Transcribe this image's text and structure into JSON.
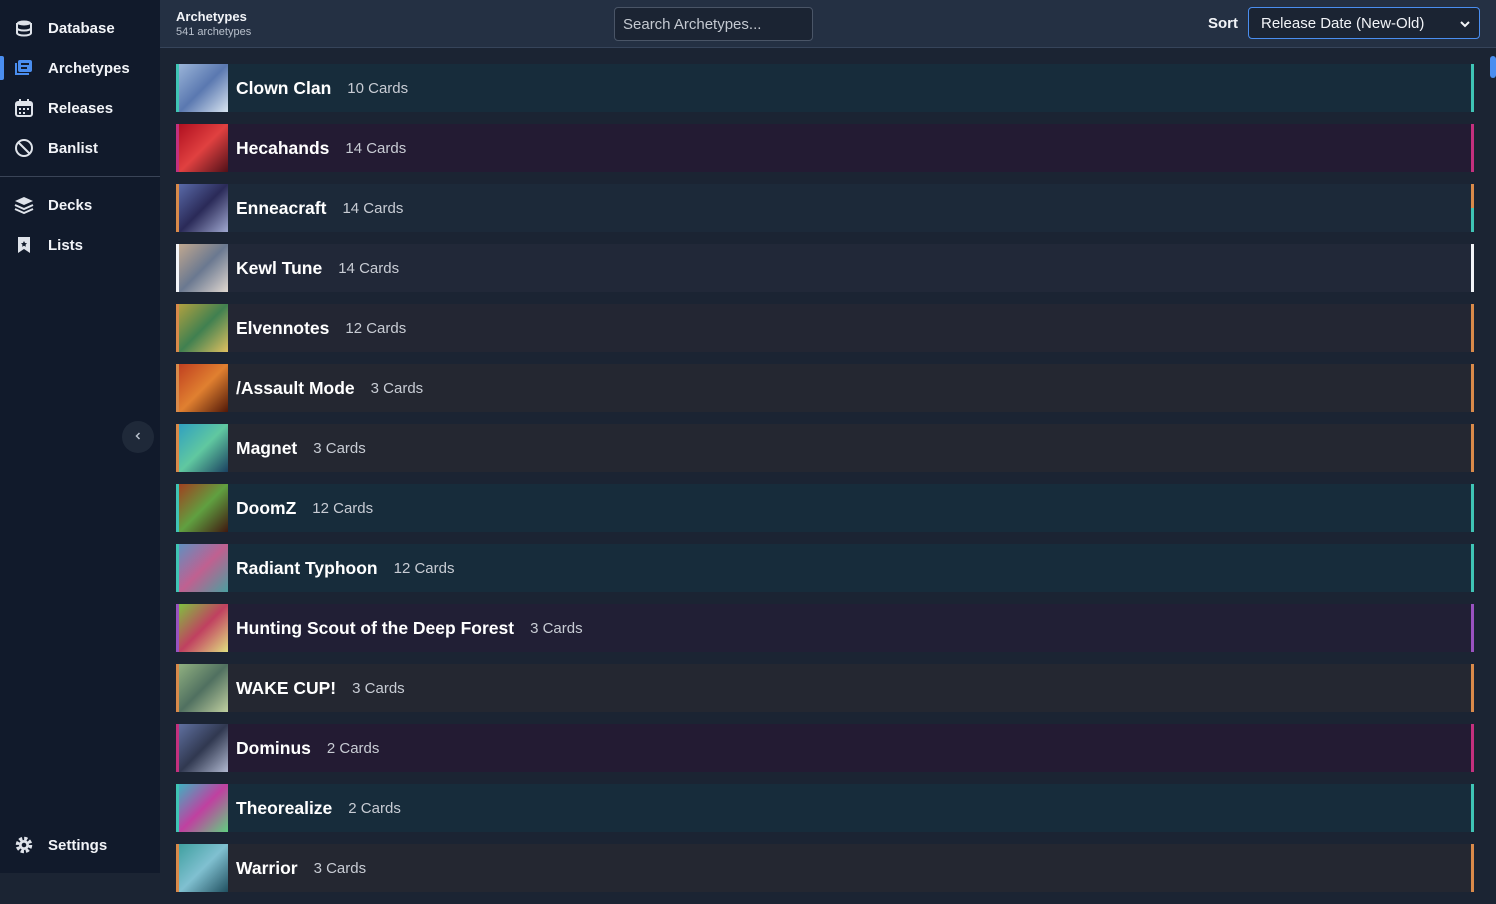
{
  "sidebar": {
    "nav": [
      {
        "label": "Database",
        "icon": "database-icon",
        "active": false
      },
      {
        "label": "Archetypes",
        "icon": "archetypes-icon",
        "active": true
      },
      {
        "label": "Releases",
        "icon": "calendar-icon",
        "active": false
      },
      {
        "label": "Banlist",
        "icon": "ban-icon",
        "active": false
      }
    ],
    "secondary": [
      {
        "label": "Decks",
        "icon": "layers-icon"
      },
      {
        "label": "Lists",
        "icon": "bookmark-icon"
      }
    ],
    "settings": {
      "label": "Settings",
      "icon": "gear-icon"
    }
  },
  "header": {
    "title": "Archetypes",
    "subtitle": "541 archetypes",
    "search_placeholder": "Search Archetypes...",
    "sort_label": "Sort",
    "sort_value": "Release Date (New-Old)"
  },
  "archetypes": [
    {
      "name": "Clown Clan",
      "count": "10 Cards",
      "bg": "#172c3b",
      "accent": "#3fc4b5",
      "thumb": [
        "#9ab4d8",
        "#5a78b0",
        "#d8e4f0"
      ]
    },
    {
      "name": "Hecahands",
      "count": "14 Cards",
      "bg": "#231b33",
      "accent": "#c4307e",
      "thumb": [
        "#b01020",
        "#e04040",
        "#501018"
      ]
    },
    {
      "name": "Enneacraft",
      "count": "14 Cards",
      "bg": "#1c2939",
      "accent": "#d98a4a",
      "thumb": [
        "#5a6aa8",
        "#2a2a58",
        "#a0a8d0"
      ],
      "accent2": "#3fc4b5"
    },
    {
      "name": "Kewl Tune",
      "count": "14 Cards",
      "bg": "#212838",
      "accent": "#f2f4f8",
      "thumb": [
        "#c0a890",
        "#6a7890",
        "#e0d8d0"
      ]
    },
    {
      "name": "Elvennotes",
      "count": "12 Cards",
      "bg": "#232633",
      "accent": "#d98a4a",
      "thumb": [
        "#b0a040",
        "#408050",
        "#e0c060"
      ]
    },
    {
      "name": "/Assault Mode",
      "count": "3 Cards",
      "bg": "#242731",
      "accent": "#d98a4a",
      "thumb": [
        "#c04020",
        "#e08030",
        "#501808"
      ]
    },
    {
      "name": "Magnet",
      "count": "3 Cards",
      "bg": "#242731",
      "accent": "#d98a4a",
      "thumb": [
        "#30a0c0",
        "#60c8a0",
        "#1a4060"
      ]
    },
    {
      "name": "DoomZ",
      "count": "12 Cards",
      "bg": "#172c3b",
      "accent": "#3fc4b5",
      "thumb": [
        "#a04020",
        "#60a040",
        "#401810"
      ]
    },
    {
      "name": "Radiant Typhoon",
      "count": "12 Cards",
      "bg": "#172c3b",
      "accent": "#3fc4b5",
      "thumb": [
        "#6090c0",
        "#c06090",
        "#4aa0a0"
      ]
    },
    {
      "name": "Hunting Scout of the Deep Forest",
      "count": "3 Cards",
      "bg": "#211f35",
      "accent": "#9a52c0",
      "thumb": [
        "#80c040",
        "#c04060",
        "#e0e080"
      ]
    },
    {
      "name": "WAKE CUP!",
      "count": "3 Cards",
      "bg": "#242731",
      "accent": "#d98a4a",
      "thumb": [
        "#90b080",
        "#507060",
        "#c0d0a0"
      ]
    },
    {
      "name": "Dominus",
      "count": "2 Cards",
      "bg": "#231b33",
      "accent": "#c4307e",
      "thumb": [
        "#6070a0",
        "#303850",
        "#b0b8d0"
      ]
    },
    {
      "name": "Theorealize",
      "count": "2 Cards",
      "bg": "#172c3b",
      "accent": "#3fc4b5",
      "thumb": [
        "#40b0c0",
        "#c040a0",
        "#60d080"
      ]
    },
    {
      "name": "Warrior",
      "count": "3 Cards",
      "bg": "#242731",
      "accent": "#d98a4a",
      "thumb": [
        "#40a0a0",
        "#80c0d0",
        "#205060"
      ]
    }
  ]
}
